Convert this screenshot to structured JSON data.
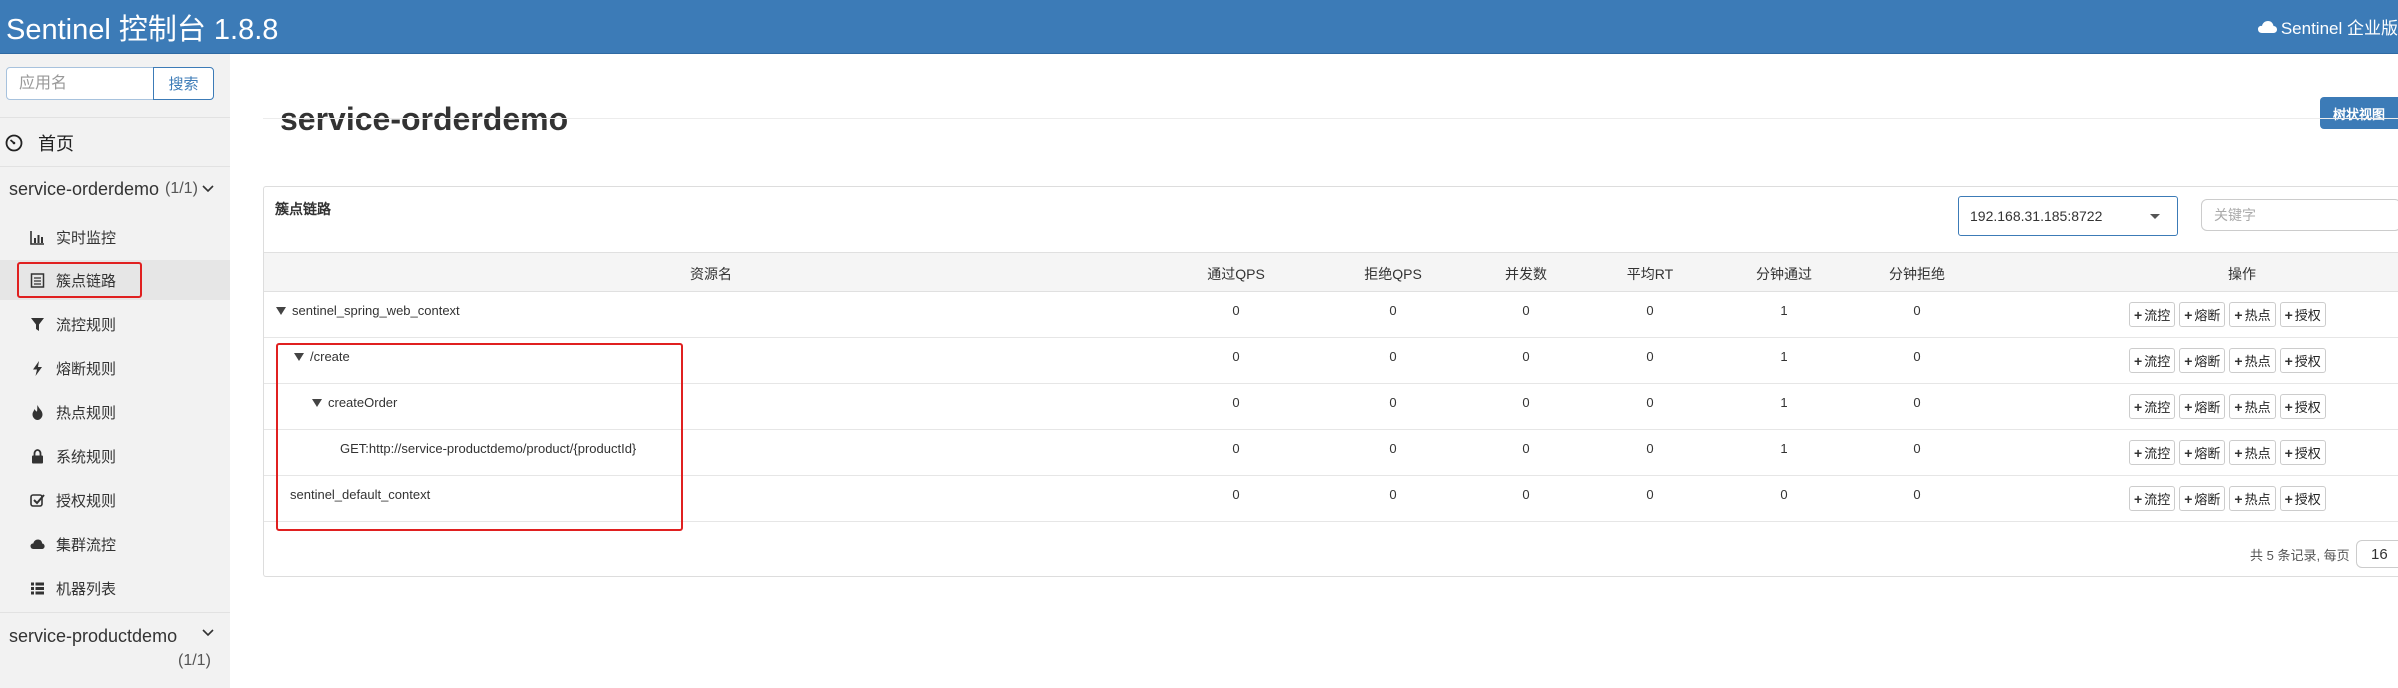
{
  "header": {
    "title": "Sentinel 控制台 1.8.8",
    "right_link": "Sentinel 企业版"
  },
  "sidebar": {
    "search_placeholder": "应用名",
    "search_button": "搜索",
    "home": "首页",
    "apps": [
      {
        "name": "service-orderdemo",
        "count": "(1/1)"
      },
      {
        "name": "service-productdemo",
        "count": "(1/1)"
      }
    ],
    "menu": [
      {
        "label": "实时监控",
        "icon": "bar-chart-icon"
      },
      {
        "label": "簇点链路",
        "icon": "list-icon",
        "active": true
      },
      {
        "label": "流控规则",
        "icon": "filter-icon"
      },
      {
        "label": "熔断规则",
        "icon": "flash-icon"
      },
      {
        "label": "热点规则",
        "icon": "fire-icon"
      },
      {
        "label": "系统规则",
        "icon": "lock-icon"
      },
      {
        "label": "授权规则",
        "icon": "check-square-icon"
      },
      {
        "label": "集群流控",
        "icon": "cloud-icon"
      },
      {
        "label": "机器列表",
        "icon": "th-list-icon"
      }
    ]
  },
  "main": {
    "page_title": "service-orderdemo",
    "tree_view_button": "树状视图",
    "panel_title": "簇点链路",
    "machine_select": "192.168.31.185:8722",
    "keyword_placeholder": "关键字",
    "columns": [
      "资源名",
      "通过QPS",
      "拒绝QPS",
      "并发数",
      "平均RT",
      "分钟通过",
      "分钟拒绝",
      "操作"
    ],
    "rows": [
      {
        "name": "sentinel_spring_web_context",
        "expandable": true,
        "values": [
          "0",
          "0",
          "0",
          "0",
          "1",
          "0"
        ]
      },
      {
        "name": "/create",
        "expandable": true,
        "values": [
          "0",
          "0",
          "0",
          "0",
          "1",
          "0"
        ]
      },
      {
        "name": "createOrder",
        "expandable": true,
        "values": [
          "0",
          "0",
          "0",
          "0",
          "1",
          "0"
        ]
      },
      {
        "name": "GET:http://service-productdemo/product/{productId}",
        "expandable": false,
        "values": [
          "0",
          "0",
          "0",
          "0",
          "1",
          "0"
        ]
      },
      {
        "name": "sentinel_default_context",
        "expandable": false,
        "values": [
          "0",
          "0",
          "0",
          "0",
          "0",
          "0"
        ]
      }
    ],
    "ops": [
      "流控",
      "熔断",
      "热点",
      "授权"
    ],
    "pager": {
      "text": "共 5 条记录, 每页",
      "page_size": "16"
    }
  },
  "colors": {
    "header_bg": "#3c7bb7",
    "accent": "#3c7bb7",
    "highlight_box": "#e02020"
  }
}
